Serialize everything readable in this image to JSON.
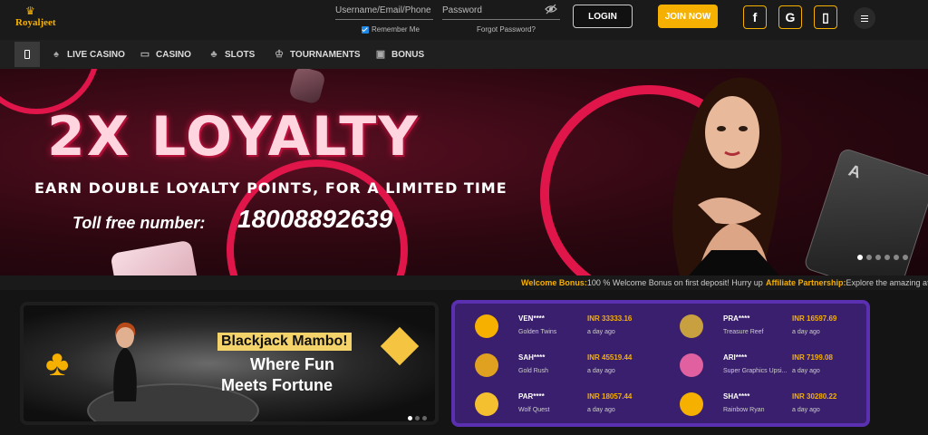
{
  "brand": {
    "logo_text": "Royaljeet"
  },
  "header": {
    "username_placeholder": "Username/Email/Phone",
    "password_placeholder": "Password",
    "remember_label": "Remember Me",
    "forgot_label": "Forgot Password?",
    "login_label": "LOGIN",
    "join_label": "JOIN NOW",
    "social": [
      {
        "icon": "facebook-icon",
        "glyph": "f"
      },
      {
        "icon": "google-icon",
        "glyph": "G"
      },
      {
        "icon": "phone-icon",
        "glyph": "▯"
      }
    ]
  },
  "nav": {
    "items": [
      {
        "label": "LIVE CASINO",
        "icon": "live-casino-icon"
      },
      {
        "label": "CASINO",
        "icon": "casino-icon"
      },
      {
        "label": "SLOTS",
        "icon": "slots-icon"
      },
      {
        "label": "TOURNAMENTS",
        "icon": "trophy-icon"
      },
      {
        "label": "BONUS",
        "icon": "gift-icon"
      }
    ]
  },
  "hero": {
    "title": "2X LOYALTY",
    "subtitle": "EARN DOUBLE LOYALTY POINTS, FOR A LIMITED TIME",
    "toll_label": "Toll free number:",
    "toll_number": "18008892639",
    "card_rank": "A",
    "slide_count": 6,
    "active_slide": 0
  },
  "ticker": [
    {
      "key": "Welcome Bonus:",
      "value": "100 % Welcome Bonus on first deposit! Hurry up"
    },
    {
      "key": "Affiliate Partnership:",
      "value": "Explore the amazing affili"
    }
  ],
  "promo": {
    "line1": "Blackjack Mambo!",
    "line2": "Where Fun",
    "line3": "Meets Fortune"
  },
  "winners": [
    {
      "name": "VEN****",
      "game": "Golden Twins",
      "amount": "INR 33333.16",
      "time": "a day ago",
      "color": "#f5b000"
    },
    {
      "name": "PRA****",
      "game": "Treasure Reef",
      "amount": "INR 16597.69",
      "time": "a day ago",
      "color": "#c8a040"
    },
    {
      "name": "SAH****",
      "game": "Gold Rush",
      "amount": "INR 45519.44",
      "time": "a day ago",
      "color": "#e0a020"
    },
    {
      "name": "ARI****",
      "game": "Super Graphics Upsi...",
      "amount": "INR 7199.08",
      "time": "a day ago",
      "color": "#e060a0"
    },
    {
      "name": "PAR****",
      "game": "Wolf Quest",
      "amount": "INR 18057.44",
      "time": "a day ago",
      "color": "#f5c030"
    },
    {
      "name": "SHA****",
      "game": "Rainbow Ryan",
      "amount": "INR 30280.22",
      "time": "a day ago",
      "color": "#f5b000"
    }
  ]
}
